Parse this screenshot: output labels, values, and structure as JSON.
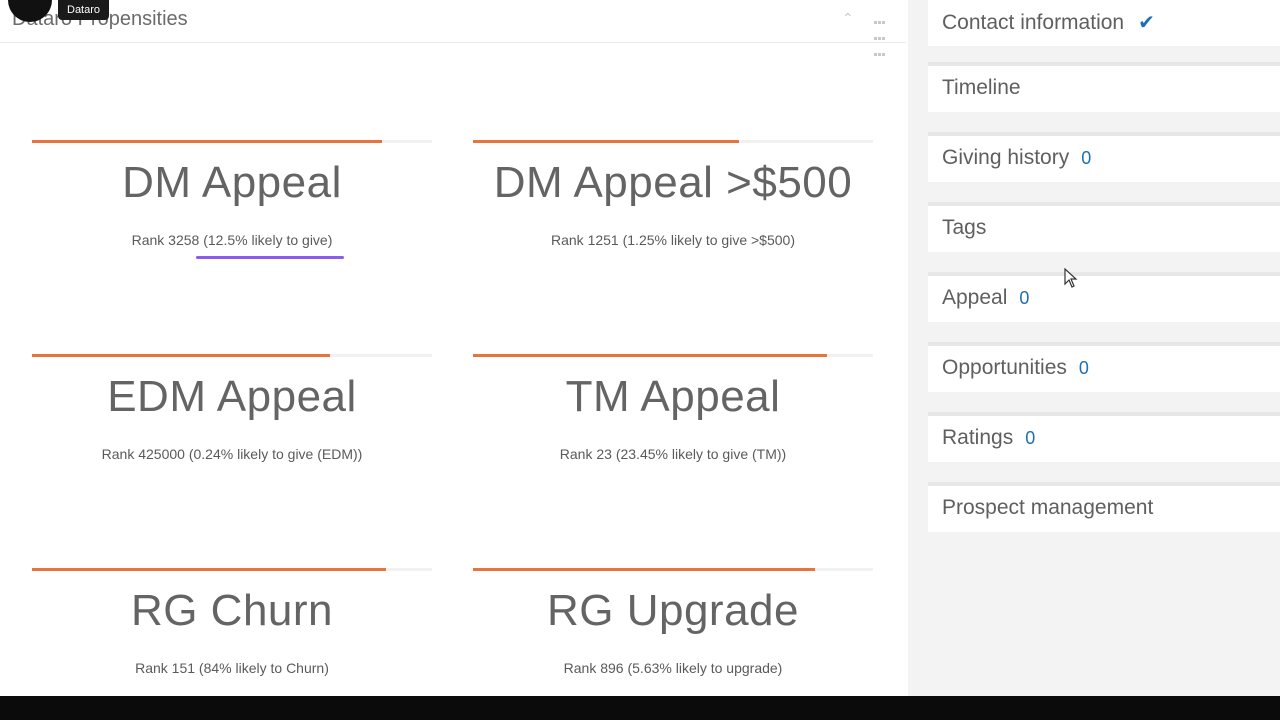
{
  "overlay": {
    "badge": "Dataro"
  },
  "main": {
    "title": "Dataro Propensities",
    "cards": [
      {
        "title": "DM Appeal",
        "rank": "Rank 3258 (12.5% likely to give)",
        "fill": 0.875
      },
      {
        "title": "DM Appeal >$500",
        "rank": "Rank 1251 (1.25% likely to give >$500)",
        "fill": 0.665
      },
      {
        "title": "EDM Appeal",
        "rank": "Rank 425000 (0.24% likely to give (EDM))",
        "fill": 0.745
      },
      {
        "title": "TM Appeal",
        "rank": "Rank 23 (23.45% likely to give (TM))",
        "fill": 0.885
      },
      {
        "title": "RG Churn",
        "rank": "Rank 151 (84% likely to Churn)",
        "fill": 0.885
      },
      {
        "title": "RG Upgrade",
        "rank": "Rank 896 (5.63% likely to upgrade)",
        "fill": 0.855
      }
    ]
  },
  "sidebar": {
    "items": [
      {
        "label": "Contact information",
        "count": ""
      },
      {
        "label": "Timeline",
        "count": ""
      },
      {
        "label": "Giving history",
        "count": "0"
      },
      {
        "label": "Tags",
        "count": ""
      },
      {
        "label": "Appeal",
        "count": "0"
      },
      {
        "label": "Opportunities",
        "count": "0"
      },
      {
        "label": "Ratings",
        "count": "0"
      },
      {
        "label": "Prospect management",
        "count": ""
      }
    ]
  },
  "colors": {
    "accent": "#e8743b",
    "link": "#1f6fb4",
    "highlight": "#8a5cf0"
  },
  "icons": [
    "chevron-up-icon",
    "grid-icon",
    "check-icon",
    "cursor-icon"
  ]
}
